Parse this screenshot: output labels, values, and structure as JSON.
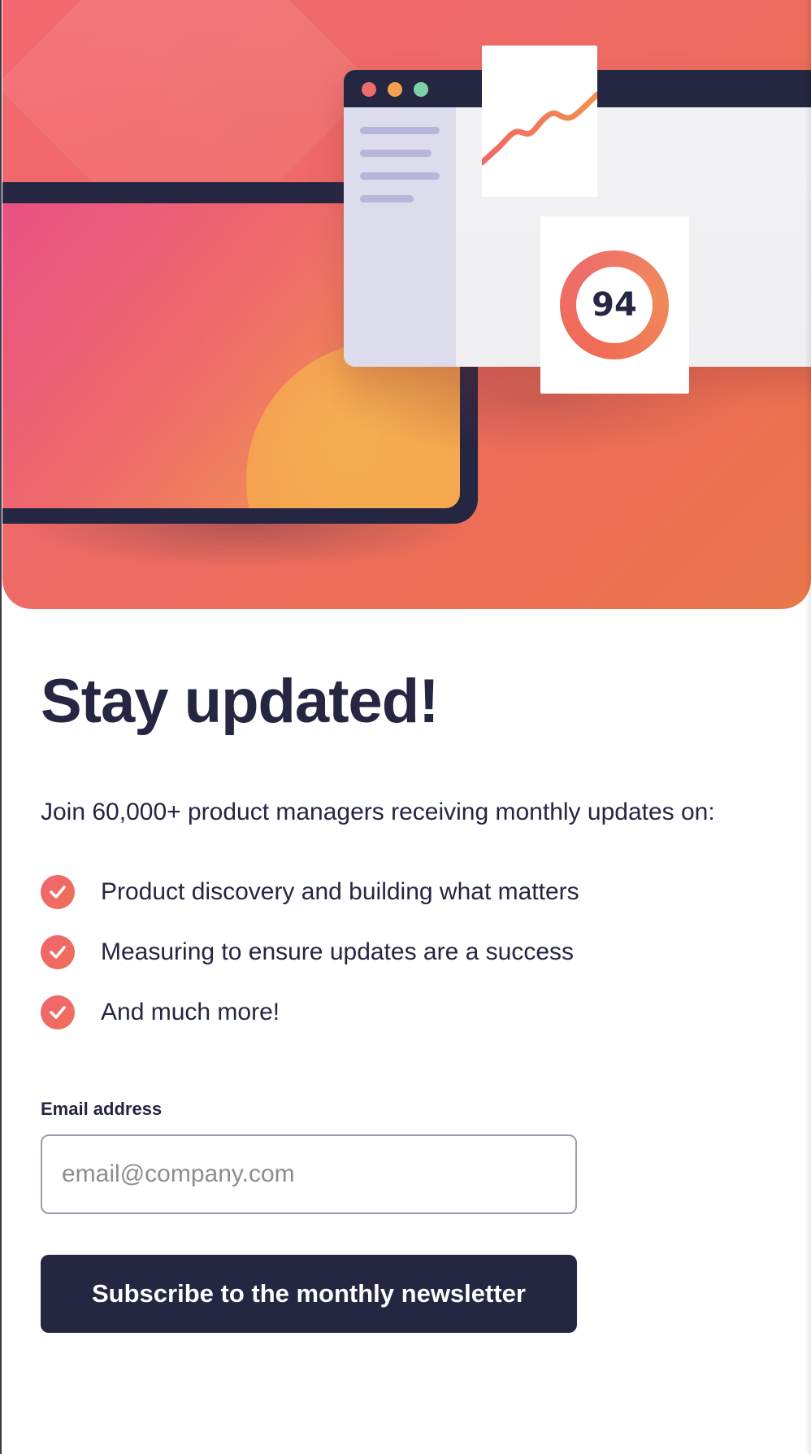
{
  "hero": {
    "dashboard": {
      "window_dots": [
        {
          "name": "close-dot",
          "color": "#ef6b6b"
        },
        {
          "name": "minimize-dot",
          "color": "#f4a04e"
        },
        {
          "name": "maximize-dot",
          "color": "#7dd3a5"
        }
      ],
      "score": "94"
    }
  },
  "colors": {
    "navy": "#242642",
    "accent": "#ee6a62",
    "hero_pink": "#ea4f87",
    "hero_orange": "#f3a04e"
  },
  "newsletter": {
    "title": "Stay updated!",
    "intro": "Join 60,000+ product managers receiving monthly updates on:",
    "features": [
      {
        "text": "Product discovery and building what matters",
        "icon": "check-icon"
      },
      {
        "text": "Measuring to ensure updates are a success",
        "icon": "check-icon"
      },
      {
        "text": "And much more!",
        "icon": "check-icon"
      }
    ],
    "email": {
      "label": "Email address",
      "placeholder": "email@company.com",
      "value": ""
    },
    "subscribe_label": "Subscribe to the monthly newsletter"
  }
}
